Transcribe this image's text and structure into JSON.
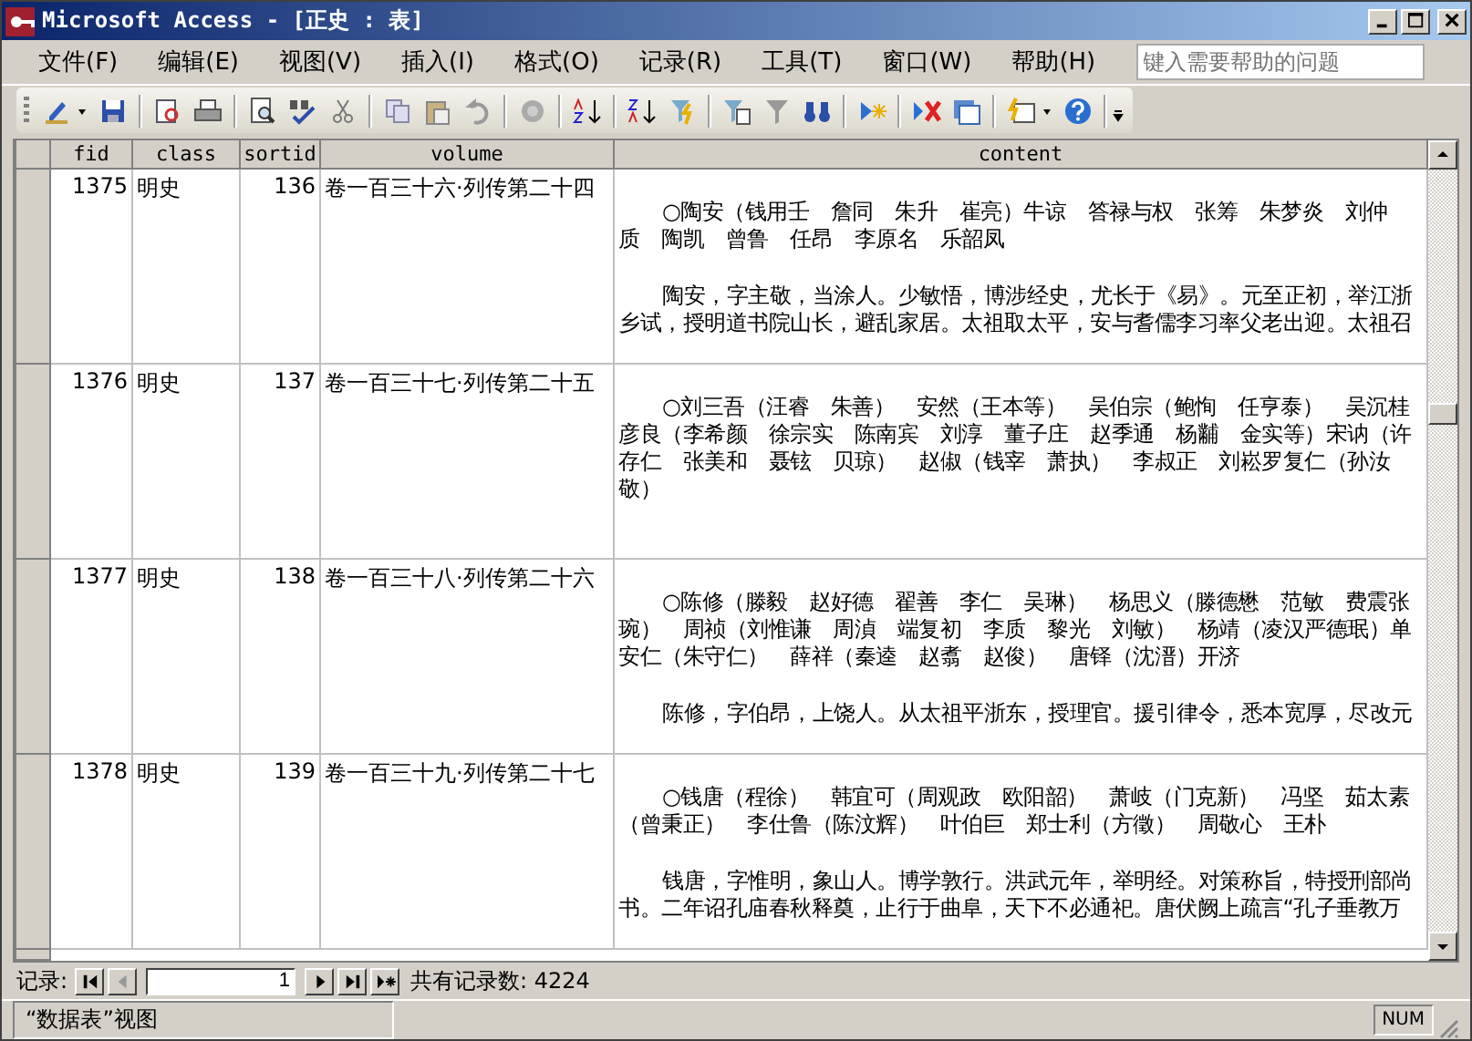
{
  "window": {
    "title": "Microsoft Access - [正史 : 表]"
  },
  "menu": [
    "文件(F)",
    "编辑(E)",
    "视图(V)",
    "插入(I)",
    "格式(O)",
    "记录(R)",
    "工具(T)",
    "窗口(W)",
    "帮助(H)"
  ],
  "help_search": {
    "placeholder": "键入需要帮助的问题"
  },
  "table": {
    "columns": [
      "fid",
      "class",
      "sortid",
      "volume",
      "content"
    ],
    "rows": [
      {
        "fid": "1375",
        "class": "明史",
        "sortid": "136",
        "volume": "卷一百三十六·列传第二十四",
        "content": [
          "○陶安（钱用壬　詹同　朱升　崔亮）牛谅　答禄与权　张筹　朱梦炎　刘仲质　陶凯　曾鲁　任昂　李原名　乐韶凤",
          "陶安，字主敬，当涂人。少敏悟，博涉经史，尤长于《易》。元至正初，举江浙乡试，授明道书院山长，避乱家居。太祖取太平，安与耆儒李习率父老出迎。太祖召"
        ]
      },
      {
        "fid": "1376",
        "class": "明史",
        "sortid": "137",
        "volume": "卷一百三十七·列传第二十五",
        "content": [
          "○刘三吾（汪睿　朱善）　安然（王本等）　吴伯宗（鲍恂　任亨泰）　吴沉桂彦良（李希颜　徐宗实　陈南宾　刘淳　董子庄　赵季通　杨黼　金实等）宋讷（许存仁　张美和　聂铉　贝琼）　赵俶（钱宰　萧执）　李叔正　刘崧罗复仁（孙汝敬）"
        ]
      },
      {
        "fid": "1377",
        "class": "明史",
        "sortid": "138",
        "volume": "卷一百三十八·列传第二十六",
        "content": [
          "○陈修（滕毅　赵好德　翟善　李仁　吴琳）　杨思义（滕德懋　范敏　费震张琬）　周祯（刘惟谦　周湞　端复初　李质　黎光　刘敏）　杨靖（凌汉严德珉）单安仁（朱守仁）　薛祥（秦逵　赵翥　赵俊）　唐铎（沈溍）开济",
          "陈修，字伯昂，上饶人。从太祖平浙东，授理官。援引律令，悉本宽厚，尽改元"
        ]
      },
      {
        "fid": "1378",
        "class": "明史",
        "sortid": "139",
        "volume": "卷一百三十九·列传第二十七",
        "content": [
          "○钱唐（程徐）　韩宜可（周观政　欧阳韶）　萧岐（门克新）　冯坚　茹太素（曾秉正）　李仕鲁（陈汶辉）　叶伯巨　郑士利（方徵）　周敬心　王朴",
          "钱唐，字惟明，象山人。博学敦行。洪武元年，举明经。对策称旨，特授刑部尚书。二年诏孔庙春秋释奠，止行于曲阜，天下不必通祀。唐伏阙上疏言“孔子垂教万"
        ]
      }
    ]
  },
  "navigator": {
    "label": "记录:",
    "current": "1",
    "total": "共有记录数: 4224"
  },
  "status_bar": {
    "view": "“数据表”视图",
    "indicator": "NUM"
  }
}
